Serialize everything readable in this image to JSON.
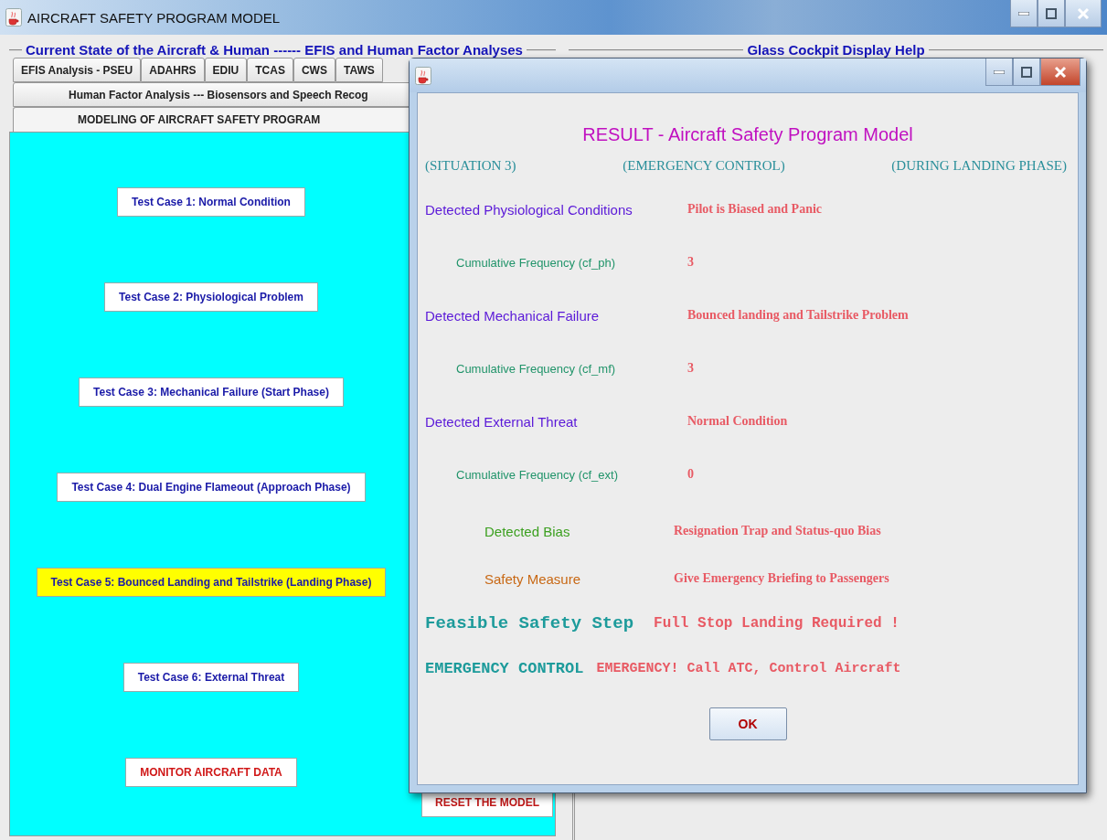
{
  "window": {
    "title": "AIRCRAFT  SAFETY  PROGRAM  MODEL"
  },
  "left_section": {
    "title": "Current State of the Aircraft & Human   ------  EFIS and Human Factor Analyses"
  },
  "right_section": {
    "title": "Glass Cockpit Display Help"
  },
  "tab_rows": [
    [
      {
        "label": "EFIS  Analysis  -  PSEU",
        "selected": false
      },
      {
        "label": "ADAHRS",
        "selected": false
      },
      {
        "label": "EDIU",
        "selected": false
      },
      {
        "label": "TCAS",
        "selected": false
      },
      {
        "label": "CWS",
        "selected": false
      },
      {
        "label": "TAWS",
        "selected": false
      }
    ],
    [
      {
        "label": "Human Factor Analysis   ---   Biosensors and Speech Recog",
        "selected": false
      }
    ],
    [
      {
        "label": "MODELING OF AIRCRAFT SAFETY PROGRAM",
        "selected": true
      }
    ]
  ],
  "test_buttons": [
    {
      "label": "Test Case 1:    Normal Condition",
      "kind": "case",
      "selected": false
    },
    {
      "label": "Test Case 2:    Physiological Problem",
      "kind": "case",
      "selected": false
    },
    {
      "label": "Test Case 3:    Mechanical Failure (Start Phase)",
      "kind": "case",
      "selected": false
    },
    {
      "label": "Test Case 4:    Dual Engine Flameout (Approach Phase)",
      "kind": "case",
      "selected": false
    },
    {
      "label": "Test Case 5:    Bounced Landing and Tailstrike (Landing Phase)",
      "kind": "case",
      "selected": true
    },
    {
      "label": "Test Case 6:    External Threat",
      "kind": "case",
      "selected": false
    },
    {
      "label": "MONITOR AIRCRAFT DATA",
      "kind": "action",
      "selected": false
    }
  ],
  "reset_button": {
    "label": "RESET THE MODEL"
  },
  "dialog": {
    "heading": "RESULT - Aircraft Safety Program Model",
    "situation": [
      "(SITUATION 3)",
      "(EMERGENCY CONTROL)",
      "(DURING LANDING PHASE)"
    ],
    "rows": [
      {
        "kind": "detected",
        "label": "Detected Physiological Conditions",
        "value": "Pilot is Biased and Panic"
      },
      {
        "kind": "frequency",
        "label": "Cumulative Frequency (cf_ph)",
        "value": "3"
      },
      {
        "kind": "detected",
        "label": "Detected Mechanical Failure",
        "value": "Bounced landing and Tailstrike Problem"
      },
      {
        "kind": "frequency",
        "label": "Cumulative Frequency (cf_mf)",
        "value": "3"
      },
      {
        "kind": "detected",
        "label": "Detected External Threat",
        "value": "Normal Condition"
      },
      {
        "kind": "frequency",
        "label": "Cumulative Frequency (cf_ext)",
        "value": "0"
      },
      {
        "kind": "bias",
        "label": "Detected Bias",
        "value": "Resignation Trap and Status-quo Bias"
      },
      {
        "kind": "measure",
        "label": "Safety Measure",
        "value": "Give Emergency Briefing to Passengers"
      },
      {
        "kind": "step",
        "label": "Feasible Safety Step",
        "value": "Full Stop Landing Required !"
      },
      {
        "kind": "control",
        "label": "EMERGENCY CONTROL",
        "value": "EMERGENCY! Call ATC, Control Aircraft"
      }
    ],
    "ok_button": "OK"
  }
}
